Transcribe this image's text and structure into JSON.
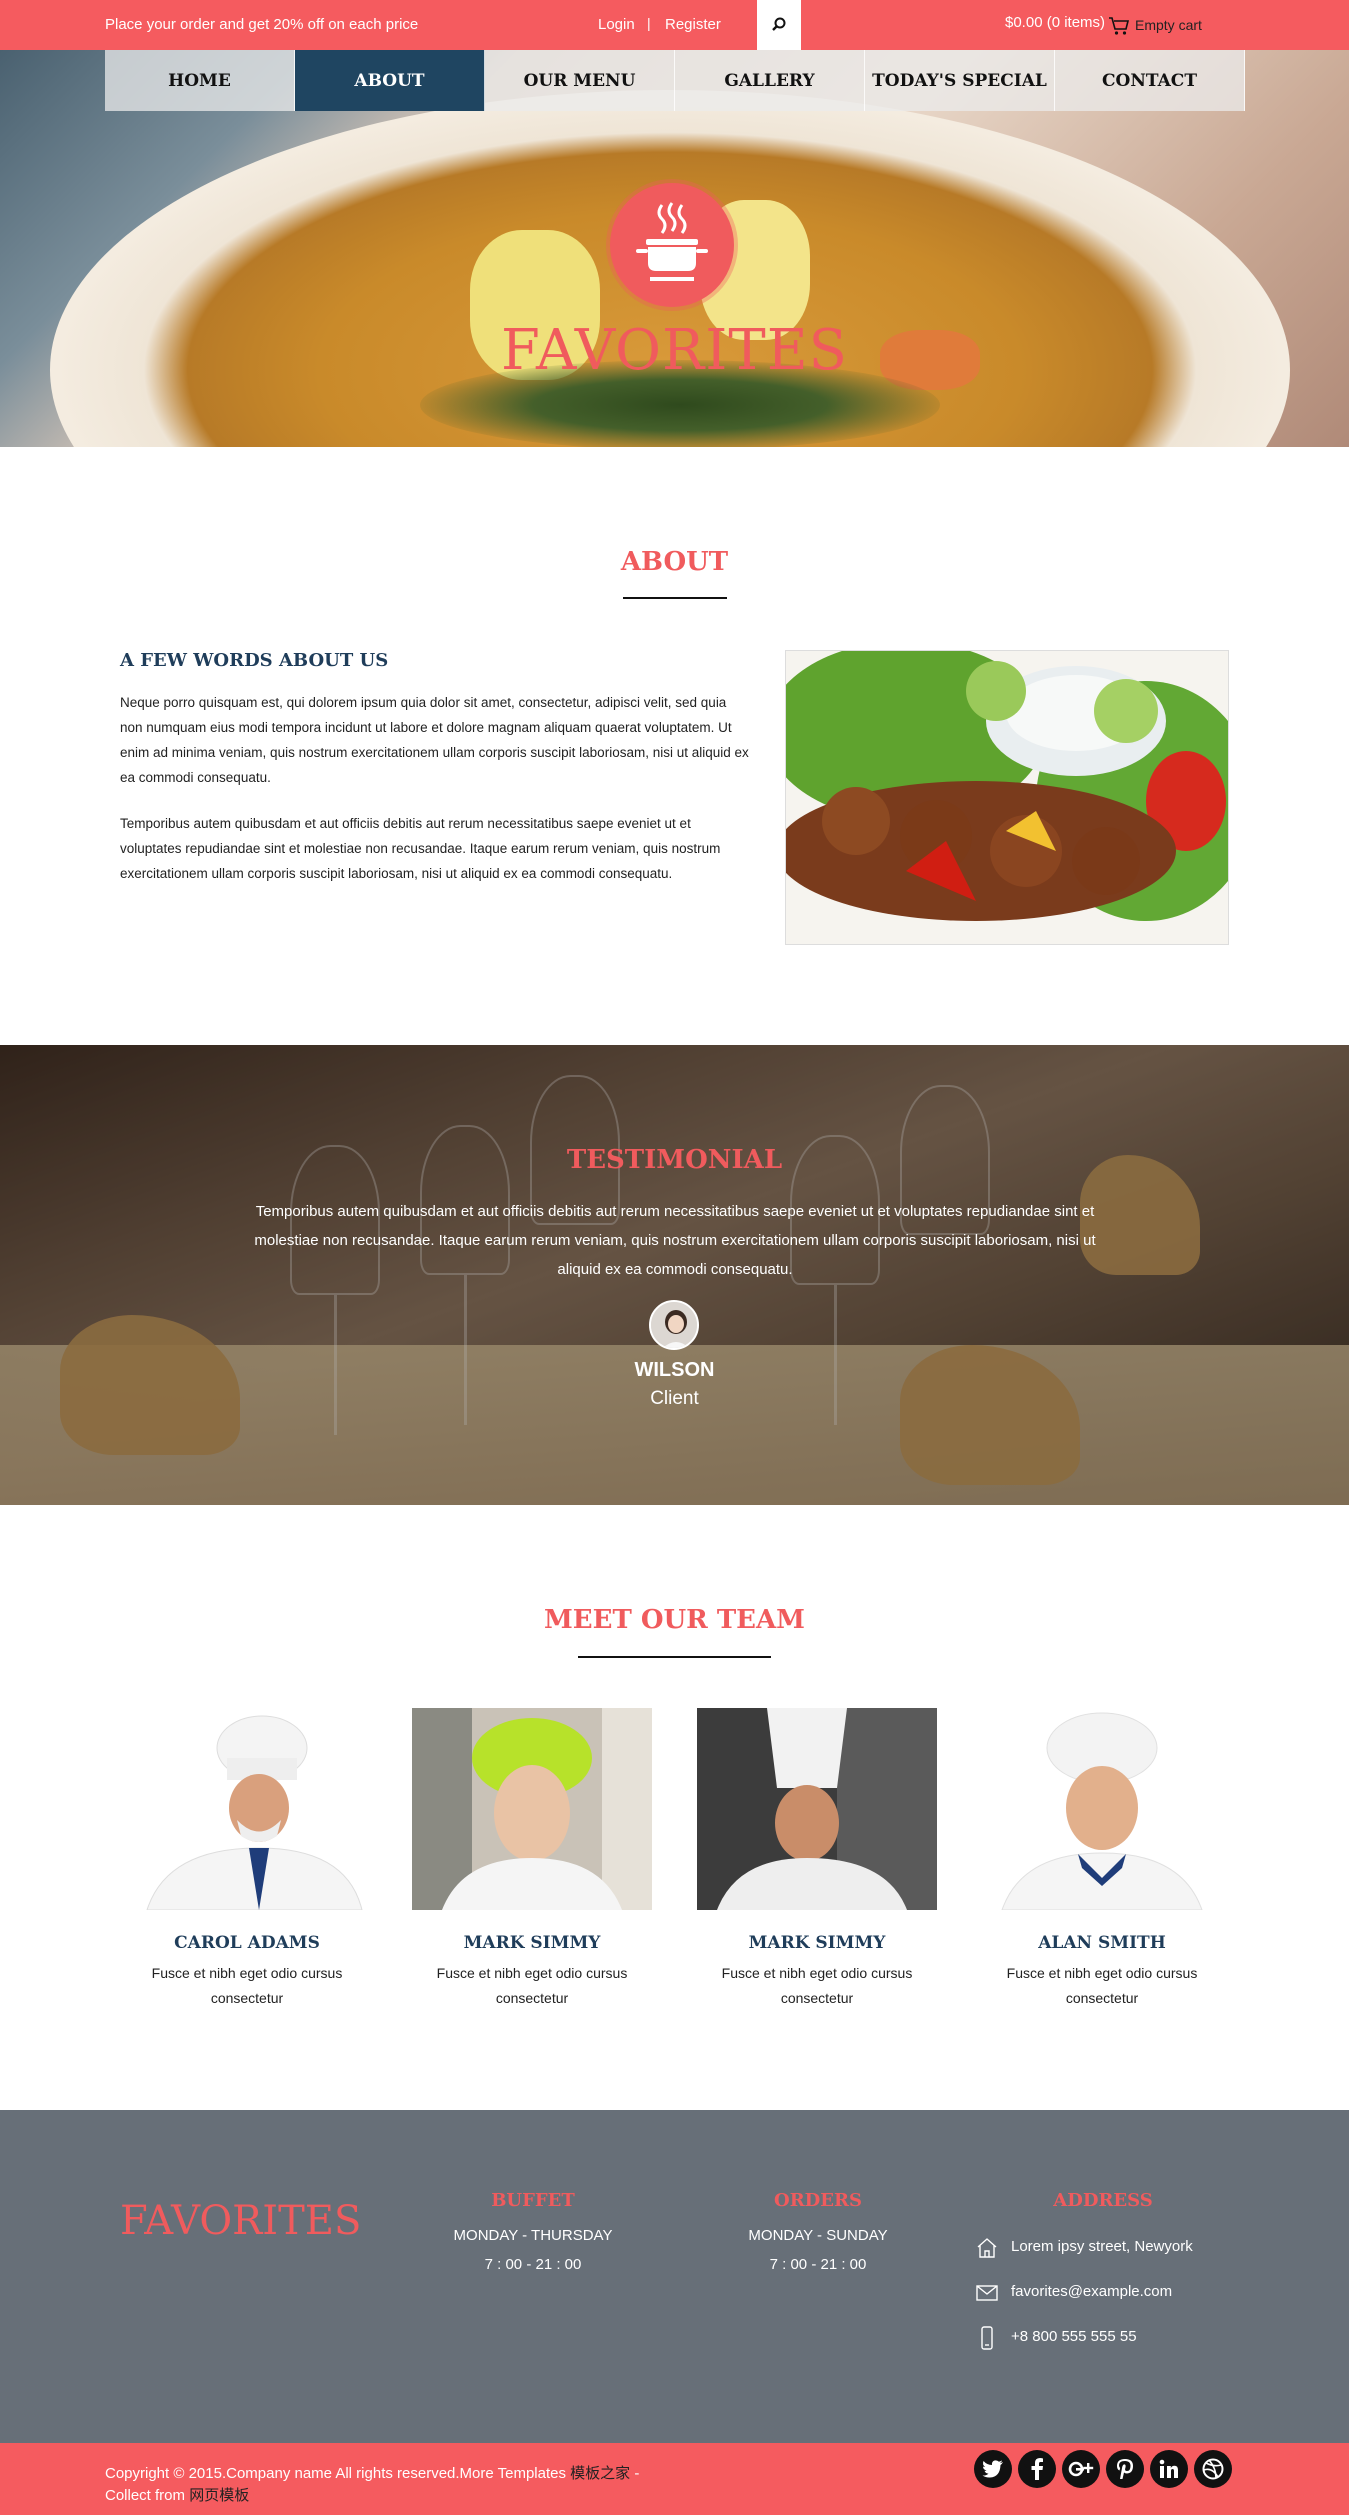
{
  "topbar": {
    "promo": "Place your order and get 20% off on each price",
    "login": "Login",
    "separator": "|",
    "register": "Register",
    "cart_total": "$0.00 (0 items)",
    "cart_label": "Empty cart"
  },
  "nav": {
    "items": [
      "HOME",
      "ABOUT",
      "OUR MENU",
      "GALLERY",
      "TODAY'S SPECIAL",
      "CONTACT"
    ],
    "active": "ABOUT"
  },
  "hero": {
    "brand": "FAVORITES"
  },
  "about": {
    "title": "ABOUT",
    "subtitle": "A FEW WORDS ABOUT US",
    "paragraph1": "Neque porro quisquam est, qui dolorem ipsum quia dolor sit amet, consectetur, adipisci velit, sed quia non numquam eius modi tempora incidunt ut labore et dolore magnam aliquam quaerat voluptatem. Ut enim ad minima veniam, quis nostrum exercitationem ullam corporis suscipit laboriosam, nisi ut aliquid ex ea commodi consequatu.",
    "paragraph2": "Temporibus autem quibusdam et aut officiis debitis aut rerum necessitatibus saepe eveniet ut et voluptates repudiandae sint et molestiae non recusandae. Itaque earum rerum veniam, quis nostrum exercitationem ullam corporis suscipit laboriosam, nisi ut aliquid ex ea commodi consequatu."
  },
  "testimonial": {
    "title": "TESTIMONIAL",
    "text": "Temporibus autem quibusdam et aut officiis debitis aut rerum necessitatibus saepe eveniet ut et voluptates repudiandae sint et molestiae non recusandae. Itaque earum rerum veniam, quis nostrum exercitationem ullam corporis suscipit laboriosam, nisi ut aliquid ex ea commodi consequatu.",
    "name": "WILSON",
    "role": "Client"
  },
  "team": {
    "title": "MEET OUR TEAM",
    "members": [
      {
        "name": "CAROL ADAMS",
        "desc": "Fusce et nibh eget odio cursus consectetur"
      },
      {
        "name": "MARK SIMMY",
        "desc": "Fusce et nibh eget odio cursus consectetur"
      },
      {
        "name": "MARK SIMMY",
        "desc": "Fusce et nibh eget odio cursus consectetur"
      },
      {
        "name": "ALAN SMITH",
        "desc": "Fusce et nibh eget odio cursus consectetur"
      }
    ]
  },
  "footer": {
    "brand": "FAVORITES",
    "buffet": {
      "title": "BUFFET",
      "days": "MONDAY - THURSDAY",
      "hours": "7 : 00 - 21 : 00"
    },
    "orders": {
      "title": "ORDERS",
      "days": "MONDAY - SUNDAY",
      "hours": "7 : 00 - 21 : 00"
    },
    "address": {
      "title": "ADDRESS",
      "street": "Lorem ipsy street, Newyork",
      "email": "favorites@example.com",
      "phone": "+8 800 555 555 55"
    }
  },
  "bottom": {
    "copyright": "Copyright © 2015.Company name All rights reserved.More Templates",
    "templates_link": "模板之家",
    "dash": " -",
    "collect": "Collect from",
    "collect_link": "网页模板",
    "social": [
      "twitter-icon",
      "facebook-icon",
      "google-plus-icon",
      "pinterest-icon",
      "linkedin-icon",
      "dribbble-icon"
    ]
  },
  "colors": {
    "accent": "#f55b5f",
    "navy": "#1f4561",
    "footer": "#676f78"
  }
}
